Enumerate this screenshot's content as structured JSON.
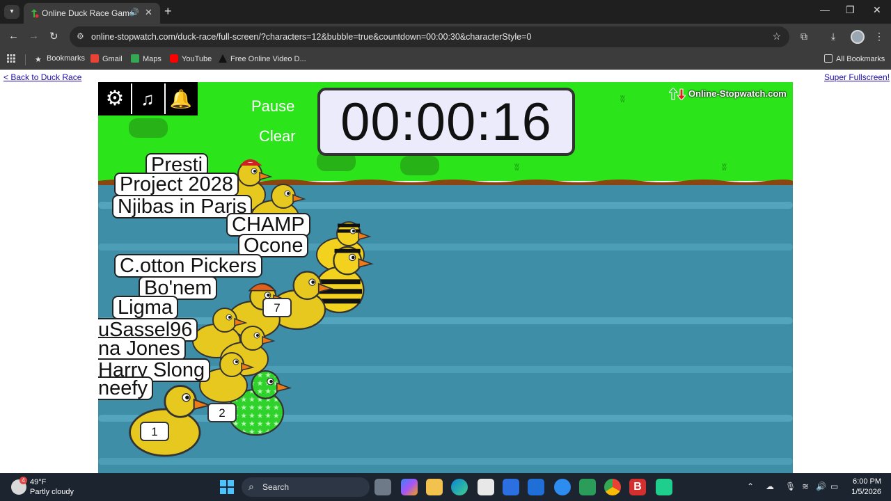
{
  "browser": {
    "tab": {
      "title": "Online Duck Race Game"
    },
    "url": "online-stopwatch.com/duck-race/full-screen/?characters=12&bubble=true&countdown=00:00:30&characterStyle=0",
    "bookmarks": [
      "Bookmarks",
      "Gmail",
      "Maps",
      "YouTube",
      "Free Online Video D...",
      "All Bookmarks"
    ]
  },
  "page": {
    "back_link": "< Back to Duck Race",
    "fullscreen_link": "Super Fullscreen!"
  },
  "game": {
    "pause_label": "Pause",
    "clear_label": "Clear",
    "timer": "00:00:16",
    "logo_text": "Online-Stopwatch.com",
    "ducks": [
      {
        "name": "Presti"
      },
      {
        "name": "Project 2028"
      },
      {
        "name": "Njibas in Paris"
      },
      {
        "name": "CHAMP"
      },
      {
        "name": "Ocone"
      },
      {
        "name": "C.otton Pickers"
      },
      {
        "name": "Bo'nem"
      },
      {
        "name": "Ligma"
      },
      {
        "name": "uSassel96"
      },
      {
        "name": "na Jones"
      },
      {
        "name": "Harry Slong"
      },
      {
        "name": "neefy"
      }
    ],
    "lane_badges": [
      "7",
      "2",
      "1"
    ]
  },
  "taskbar": {
    "weather_temp": "49°F",
    "weather_desc": "Partly cloudy",
    "weather_badge": "4",
    "search_label": "Search",
    "time": "6:00 PM",
    "date": "1/5/2026"
  }
}
